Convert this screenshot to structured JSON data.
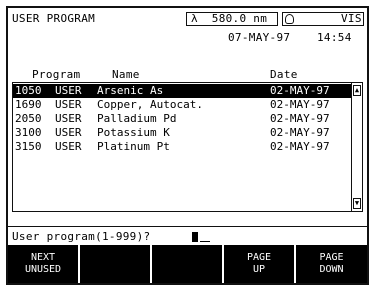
{
  "header": {
    "title": "USER PROGRAM",
    "wavelength": "λ  580.0 nm",
    "lamp": "VIS",
    "date": "07-MAY-97",
    "time": "14:54"
  },
  "columns": {
    "program": "Program",
    "name": "Name",
    "date": "Date"
  },
  "rows": [
    {
      "num": "1050",
      "owner": "USER",
      "name": "Arsenic As",
      "date": "02-MAY-97",
      "selected": true
    },
    {
      "num": "1690",
      "owner": "USER",
      "name": "Copper, Autocat.",
      "date": "02-MAY-97",
      "selected": false
    },
    {
      "num": "2050",
      "owner": "USER",
      "name": "Palladium Pd",
      "date": "02-MAY-97",
      "selected": false
    },
    {
      "num": "3100",
      "owner": "USER",
      "name": "Potassium K",
      "date": "02-MAY-97",
      "selected": false
    },
    {
      "num": "3150",
      "owner": "USER",
      "name": "Platinum Pt",
      "date": "02-MAY-97",
      "selected": false
    }
  ],
  "prompt": "User program(1-999)?",
  "softkeys": [
    {
      "line1": "NEXT",
      "line2": "UNUSED"
    },
    {
      "line1": "",
      "line2": ""
    },
    {
      "line1": "",
      "line2": ""
    },
    {
      "line1": "PAGE",
      "line2": "UP"
    },
    {
      "line1": "PAGE",
      "line2": "DOWN"
    }
  ]
}
